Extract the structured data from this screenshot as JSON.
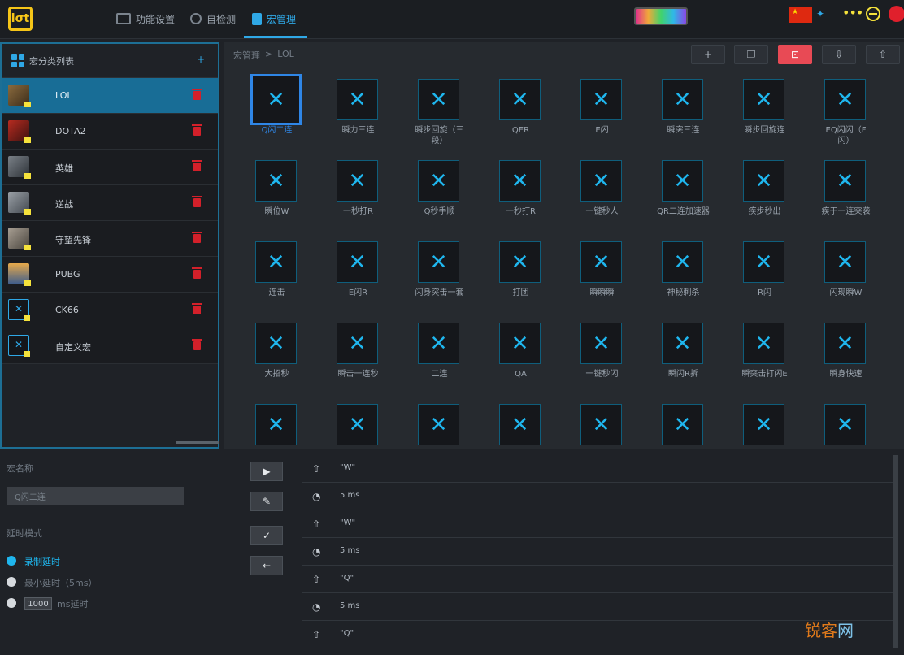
{
  "app": {
    "logo_text": "lσt",
    "tabs": [
      {
        "label": "功能设置"
      },
      {
        "label": "自检测"
      },
      {
        "label": "宏管理"
      }
    ]
  },
  "sidebar": {
    "header": "宏分类列表",
    "add_label": "+",
    "items": [
      {
        "name": "LOL"
      },
      {
        "name": "DOTA2"
      },
      {
        "name": "英雄"
      },
      {
        "name": "逆战"
      },
      {
        "name": "守望先锋"
      },
      {
        "name": "PUBG"
      },
      {
        "name": "CK66"
      },
      {
        "name": "自定义宏"
      }
    ]
  },
  "main": {
    "breadcrumb": [
      "宏管理",
      ">",
      "LOL"
    ],
    "toolbar": [
      "+",
      "❐",
      "⊡",
      "⇩",
      "⇧"
    ],
    "macros": [
      "Q闪二连",
      "瞬力三连",
      "瞬步回旋（三\n段）",
      "QER",
      "E闪",
      "瞬突三连",
      "瞬步回旋连",
      "EQ闪闪（F\n闪）",
      "瞬位W",
      "一秒打R",
      "Q秒手顺",
      "一秒打R",
      "一键秒人",
      "QR二连加速器",
      "疾步秒出",
      "疾于一连突袭",
      "连击",
      "E闪R",
      "闪身突击一套",
      "打团",
      "瞬瞬瞬",
      "神秘刺杀",
      "R闪",
      "闪现瞬W",
      "大招秒",
      "瞬击一连秒",
      "二连",
      "QA",
      "一键秒闪",
      "瞬闪R拆",
      "瞬突击打闪E",
      "瞬身快速",
      "",
      "",
      "",
      "",
      "",
      "",
      "",
      ""
    ]
  },
  "editor": {
    "name_label": "宏名称",
    "name_value": "Q闪二连",
    "delay_label": "延时模式",
    "options": [
      {
        "label": "录制延时"
      },
      {
        "label": "最小延时（5ms）"
      },
      {
        "label": "ms延时",
        "value": "1000"
      }
    ]
  },
  "actions": [
    "▶",
    "✎",
    "✓",
    "←"
  ],
  "events": [
    {
      "icon": "⇧",
      "text": "\"W\""
    },
    {
      "icon": "◔",
      "text": "5 ms"
    },
    {
      "icon": "⇧",
      "text": "\"W\""
    },
    {
      "icon": "◔",
      "text": "5 ms"
    },
    {
      "icon": "⇧",
      "text": "\"Q\""
    },
    {
      "icon": "◔",
      "text": "5 ms"
    },
    {
      "icon": "⇧",
      "text": "\"Q\""
    }
  ],
  "watermark": {
    "a": "锐客",
    "b": "网"
  }
}
